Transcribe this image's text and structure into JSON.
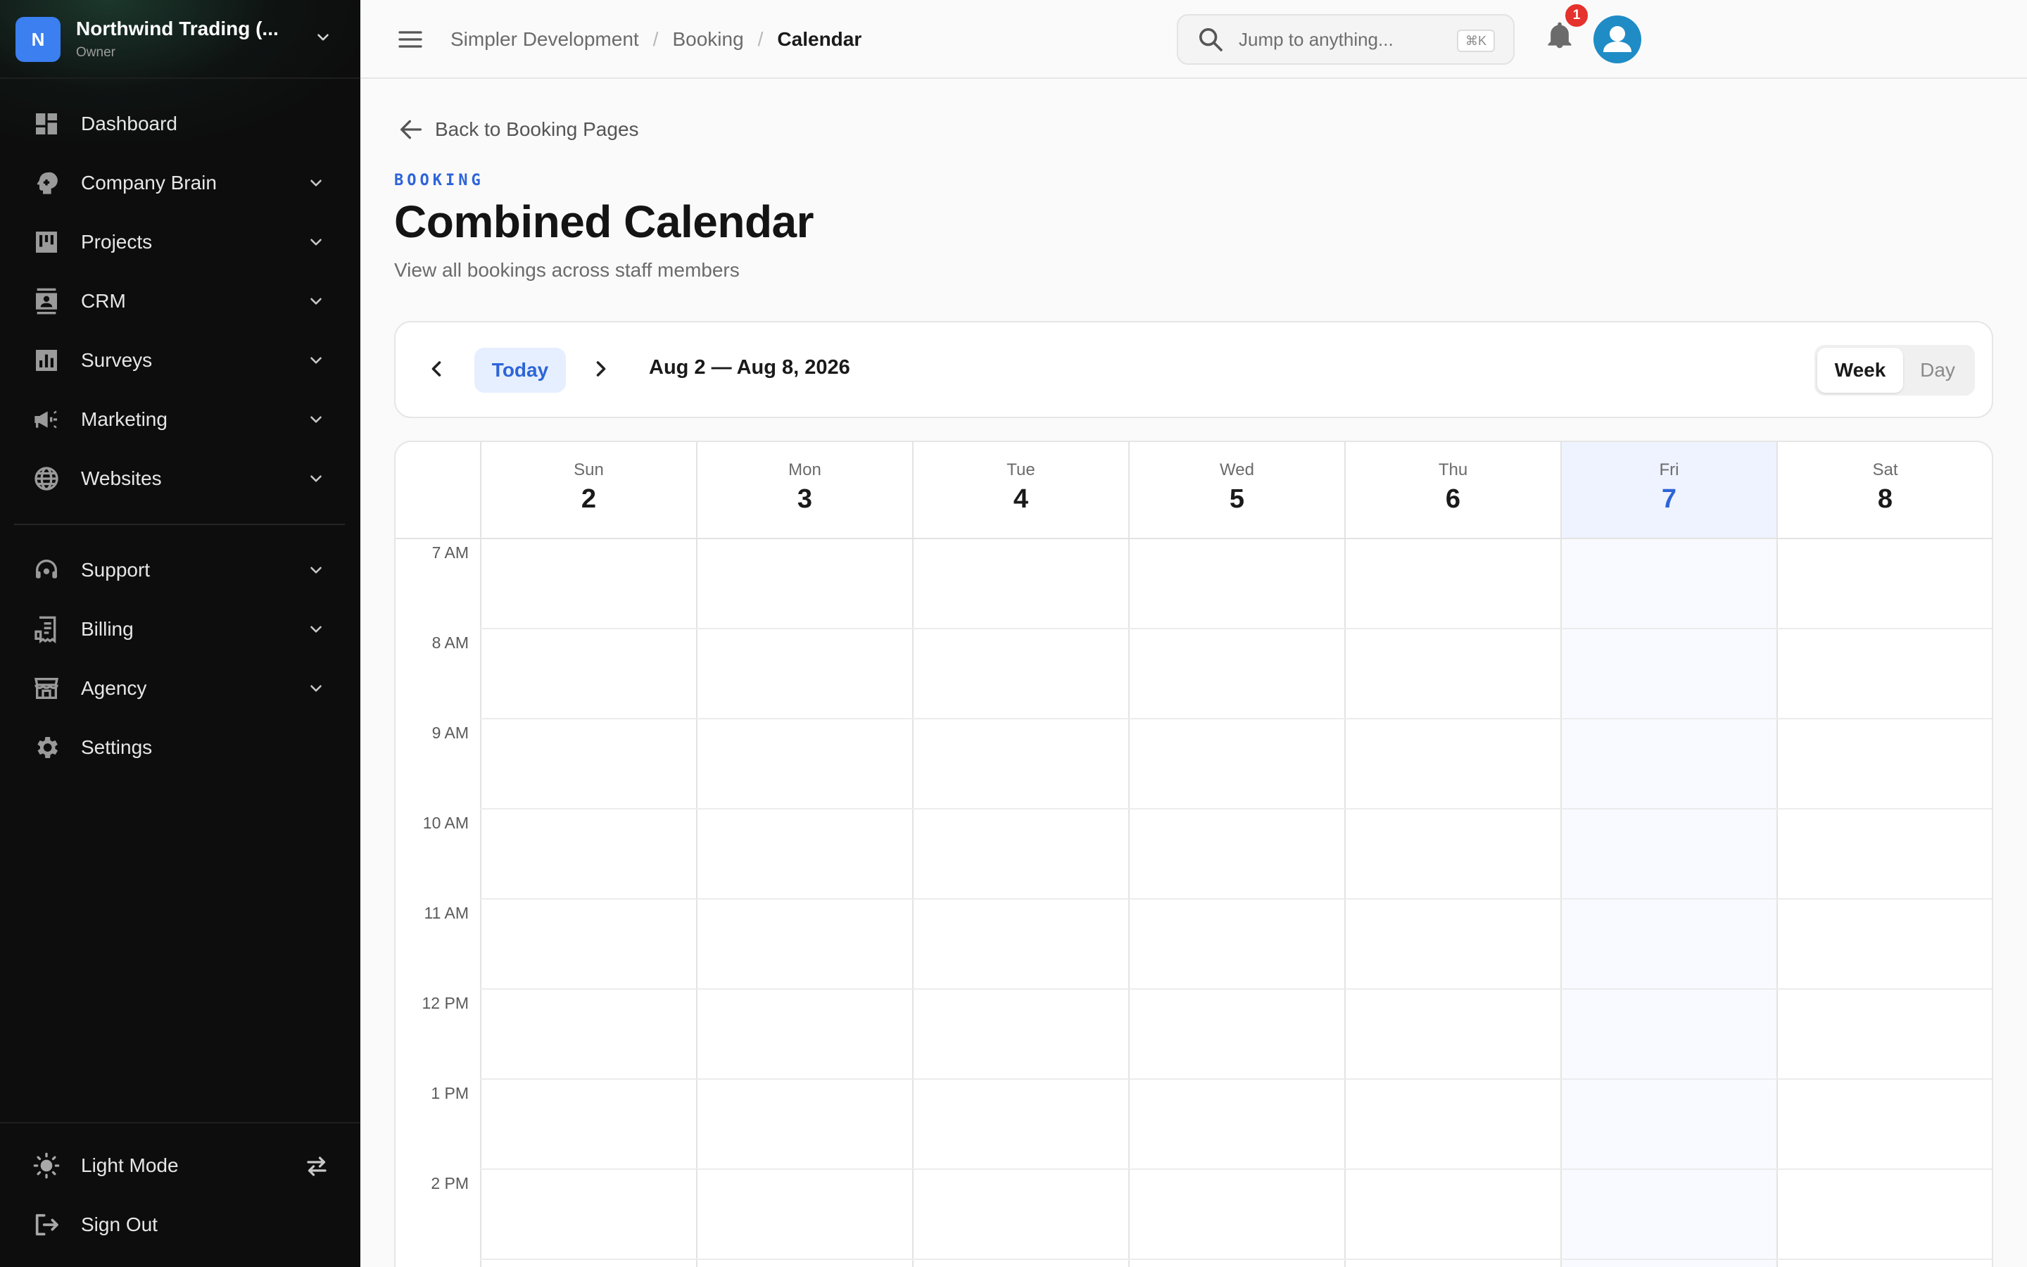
{
  "org": {
    "initial": "N",
    "name": "Northwind Trading (...",
    "role": "Owner"
  },
  "sidebar": {
    "items": [
      {
        "label": "Dashboard",
        "icon": "dashboard-icon",
        "has_chevron": false
      },
      {
        "label": "Company Brain",
        "icon": "brain-icon",
        "has_chevron": true
      },
      {
        "label": "Projects",
        "icon": "kanban-icon",
        "has_chevron": true
      },
      {
        "label": "CRM",
        "icon": "contacts-icon",
        "has_chevron": true
      },
      {
        "label": "Surveys",
        "icon": "bar-chart-icon",
        "has_chevron": true
      },
      {
        "label": "Marketing",
        "icon": "megaphone-icon",
        "has_chevron": true
      },
      {
        "label": "Websites",
        "icon": "globe-icon",
        "has_chevron": true
      },
      {
        "label": "Support",
        "icon": "headset-icon",
        "has_chevron": true
      },
      {
        "label": "Billing",
        "icon": "receipt-icon",
        "has_chevron": true
      },
      {
        "label": "Agency",
        "icon": "storefront-icon",
        "has_chevron": true
      },
      {
        "label": "Settings",
        "icon": "gear-icon",
        "has_chevron": false
      }
    ],
    "footer": {
      "theme_label": "Light Mode",
      "sign_out_label": "Sign Out"
    }
  },
  "topbar": {
    "breadcrumb": [
      "Simpler Development",
      "Booking",
      "Calendar"
    ],
    "search_placeholder": "Jump to anything...",
    "search_shortcut": "⌘K",
    "notification_count": "1"
  },
  "page": {
    "back_label": "Back to Booking Pages",
    "eyebrow": "BOOKING",
    "title": "Combined Calendar",
    "subtitle": "View all bookings across staff members"
  },
  "toolbar": {
    "today_label": "Today",
    "range_label": "Aug 2 — Aug 8, 2026",
    "views": [
      "Week",
      "Day"
    ],
    "active_view": "Week"
  },
  "calendar": {
    "days": [
      {
        "dow": "Sun",
        "date": "2",
        "today": false
      },
      {
        "dow": "Mon",
        "date": "3",
        "today": false
      },
      {
        "dow": "Tue",
        "date": "4",
        "today": false
      },
      {
        "dow": "Wed",
        "date": "5",
        "today": false
      },
      {
        "dow": "Thu",
        "date": "6",
        "today": false
      },
      {
        "dow": "Fri",
        "date": "7",
        "today": true
      },
      {
        "dow": "Sat",
        "date": "8",
        "today": false
      }
    ],
    "hours": [
      "7 AM",
      "8 AM",
      "9 AM",
      "10 AM",
      "11 AM",
      "12 PM",
      "1 PM",
      "2 PM"
    ]
  },
  "colors": {
    "accent": "#2d64d8",
    "sidebar_bg": "#0d0d0d",
    "org_avatar": "#3b7ff0",
    "badge": "#e5322d",
    "today_highlight": "#eef3ff"
  }
}
